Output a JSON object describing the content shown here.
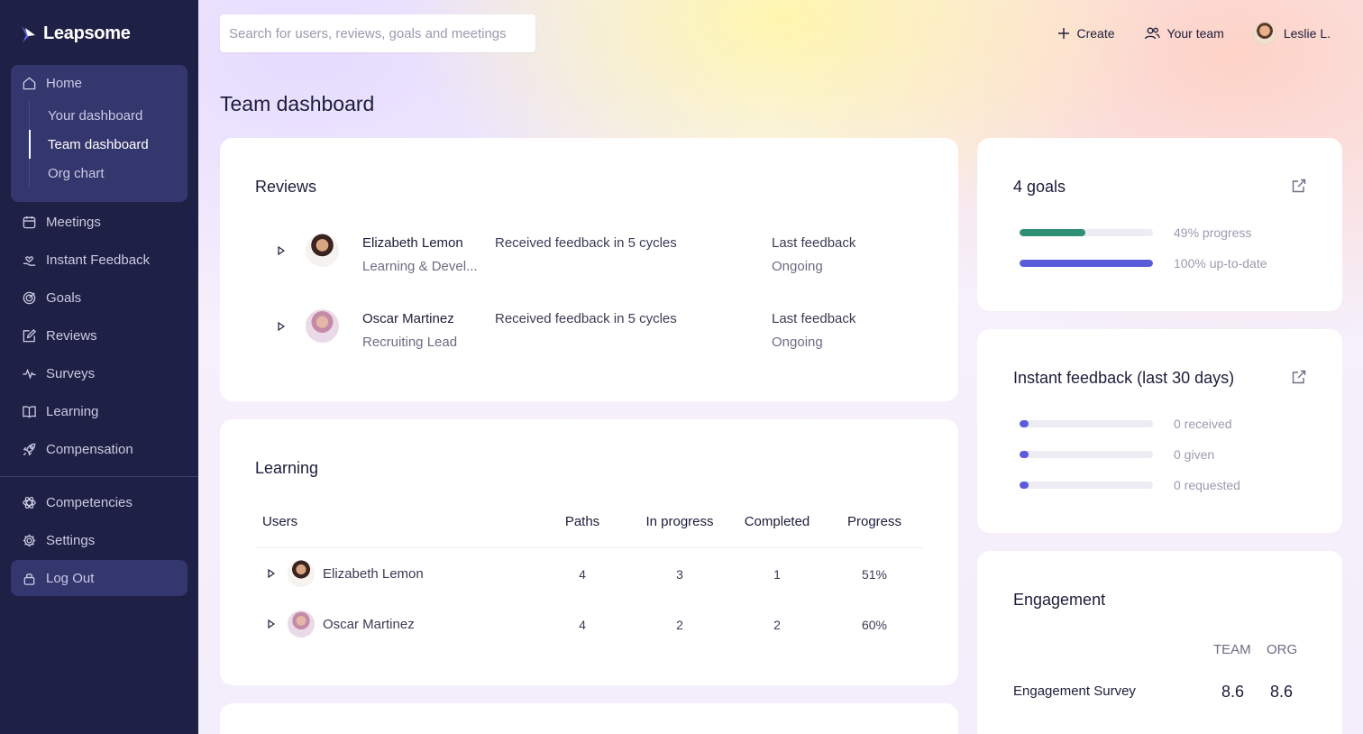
{
  "brand": {
    "name": "Leapsome"
  },
  "sidebar": {
    "home": {
      "label": "Home",
      "children": [
        "Your dashboard",
        "Team dashboard",
        "Org chart"
      ],
      "active_child": "Team dashboard"
    },
    "items": [
      {
        "label": "Meetings",
        "icon": "calendar-icon"
      },
      {
        "label": "Instant Feedback",
        "icon": "hand-heart-icon"
      },
      {
        "label": "Goals",
        "icon": "target-icon"
      },
      {
        "label": "Reviews",
        "icon": "edit-icon"
      },
      {
        "label": "Surveys",
        "icon": "pulse-icon"
      },
      {
        "label": "Learning",
        "icon": "book-icon"
      },
      {
        "label": "Compensation",
        "icon": "rocket-icon"
      }
    ],
    "bottom": [
      {
        "label": "Competencies",
        "icon": "atom-icon"
      },
      {
        "label": "Settings",
        "icon": "gear-icon"
      }
    ],
    "logout": "Log Out"
  },
  "search": {
    "placeholder": "Search for users, reviews, goals and meetings"
  },
  "header": {
    "create": "Create",
    "your_team": "Your team",
    "user": "Leslie L."
  },
  "page_title": "Team dashboard",
  "reviews": {
    "title": "Reviews",
    "rows": [
      {
        "name": "Elizabeth Lemon",
        "role": "Learning & Devel...",
        "status": "Received feedback in 5 cycles",
        "last_label": "Last feedback",
        "last_value": "Ongoing"
      },
      {
        "name": "Oscar Martinez",
        "role": "Recruiting Lead",
        "status": "Received feedback in 5 cycles",
        "last_label": "Last feedback",
        "last_value": "Ongoing"
      }
    ]
  },
  "learning": {
    "title": "Learning",
    "columns": [
      "Users",
      "Paths",
      "In progress",
      "Completed",
      "Progress"
    ],
    "rows": [
      {
        "name": "Elizabeth Lemon",
        "paths": "4",
        "in_progress": "3",
        "completed": "1",
        "progress": "51%"
      },
      {
        "name": "Oscar Martinez",
        "paths": "4",
        "in_progress": "2",
        "completed": "2",
        "progress": "60%"
      }
    ]
  },
  "goals": {
    "title": "4 goals",
    "bars": [
      {
        "label": "49% progress",
        "fraction": 0.49,
        "color": "#2f8f77"
      },
      {
        "label": "100% up-to-date",
        "fraction": 1.0,
        "color": "#5b5bdb"
      }
    ]
  },
  "instant_feedback": {
    "title": "Instant feedback (last 30 days)",
    "bars": [
      {
        "label": "0 received",
        "fraction": 0.0,
        "color": "#5b5bdb"
      },
      {
        "label": "0 given",
        "fraction": 0.0,
        "color": "#5b5bdb"
      },
      {
        "label": "0 requested",
        "fraction": 0.0,
        "color": "#5b5bdb"
      }
    ]
  },
  "engagement": {
    "title": "Engagement",
    "col_team": "TEAM",
    "col_org": "ORG",
    "rows": [
      {
        "label": "Engagement Survey",
        "team": "8.6",
        "org": "8.6"
      }
    ]
  }
}
